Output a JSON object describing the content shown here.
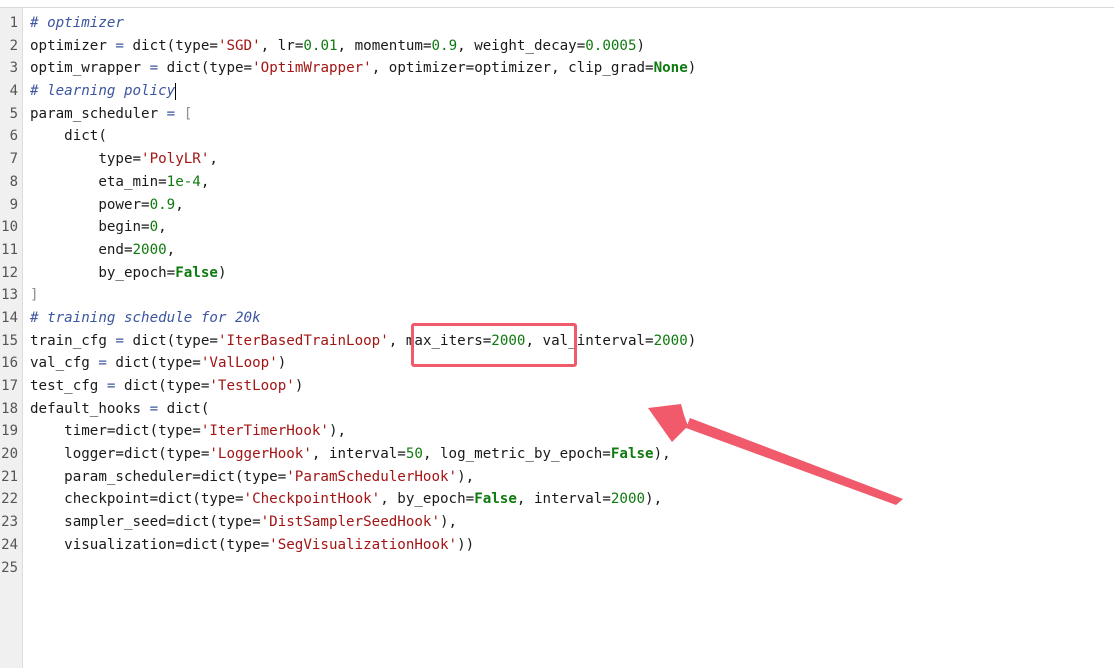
{
  "editor": {
    "lines": [
      {
        "n": "1"
      },
      {
        "n": "2"
      },
      {
        "n": "3"
      },
      {
        "n": "4"
      },
      {
        "n": "5"
      },
      {
        "n": "6"
      },
      {
        "n": "7"
      },
      {
        "n": "8"
      },
      {
        "n": "9"
      },
      {
        "n": "10"
      },
      {
        "n": "11"
      },
      {
        "n": "12"
      },
      {
        "n": "13"
      },
      {
        "n": "14"
      },
      {
        "n": "15"
      },
      {
        "n": "16"
      },
      {
        "n": "17"
      },
      {
        "n": "18"
      },
      {
        "n": "19"
      },
      {
        "n": "20"
      },
      {
        "n": "21"
      },
      {
        "n": "22"
      },
      {
        "n": "23"
      },
      {
        "n": "24"
      },
      {
        "n": "25"
      }
    ],
    "code": {
      "l1": "# optimizer",
      "l2_a": "optimizer ",
      "l2_b": "=",
      "l2_c": " dict(type=",
      "l2_d": "'SGD'",
      "l2_e": ", lr=",
      "l2_f": "0.01",
      "l2_g": ", momentum=",
      "l2_h": "0.9",
      "l2_i": ", weight_decay=",
      "l2_j": "0.0005",
      "l2_k": ")",
      "l3_a": "optim_wrapper ",
      "l3_b": "=",
      "l3_c": " dict(type=",
      "l3_d": "'OptimWrapper'",
      "l3_e": ", optimizer=optimizer, clip_grad=",
      "l3_f": "None",
      "l3_g": ")",
      "l4": "# learning policy",
      "l5_a": "param_scheduler ",
      "l5_b": "=",
      "l5_c": " [",
      "l6": "    dict(",
      "l7_a": "        type=",
      "l7_b": "'PolyLR'",
      "l7_c": ",",
      "l8_a": "        eta_min=",
      "l8_b": "1e-4",
      "l8_c": ",",
      "l9_a": "        power=",
      "l9_b": "0.9",
      "l9_c": ",",
      "l10_a": "        begin=",
      "l10_b": "0",
      "l10_c": ",",
      "l11_a": "        end=",
      "l11_b": "2000",
      "l11_c": ",",
      "l12_a": "        by_epoch=",
      "l12_b": "False",
      "l12_c": ")",
      "l13": "]",
      "l14": "# training schedule for 20k",
      "l15_a": "train_cfg ",
      "l15_b": "=",
      "l15_c": " dict(type=",
      "l15_d": "'IterBasedTrainLoop'",
      "l15_e": ", max_iters=",
      "l15_f": "2000",
      "l15_g": ", val_interval=",
      "l15_h": "2000",
      "l15_i": ")",
      "l16_a": "val_cfg ",
      "l16_b": "=",
      "l16_c": " dict(type=",
      "l16_d": "'ValLoop'",
      "l16_e": ")",
      "l17_a": "test_cfg ",
      "l17_b": "=",
      "l17_c": " dict(type=",
      "l17_d": "'TestLoop'",
      "l17_e": ")",
      "l18_a": "default_hooks ",
      "l18_b": "=",
      "l18_c": " dict(",
      "l19_a": "    timer=dict(type=",
      "l19_b": "'IterTimerHook'",
      "l19_c": "),",
      "l20_a": "    logger=dict(type=",
      "l20_b": "'LoggerHook'",
      "l20_c": ", interval=",
      "l20_d": "50",
      "l20_e": ", log_metric_by_epoch=",
      "l20_f": "False",
      "l20_g": "),",
      "l21_a": "    param_scheduler=dict(type=",
      "l21_b": "'ParamSchedulerHook'",
      "l21_c": "),",
      "l22_a": "    checkpoint=dict(type=",
      "l22_b": "'CheckpointHook'",
      "l22_c": ", by_epoch=",
      "l22_d": "False",
      "l22_e": ", interval=",
      "l22_f": "2000",
      "l22_g": "),",
      "l23_a": "    sampler_seed=dict(type=",
      "l23_b": "'DistSamplerSeedHook'",
      "l23_c": "),",
      "l24_a": "    visualization=dict(type=",
      "l24_b": "'SegVisualizationHook'",
      "l24_c": "))"
    }
  },
  "annotation": {
    "box_color": "#f05a6b",
    "arrow_color": "#f05a6b"
  }
}
